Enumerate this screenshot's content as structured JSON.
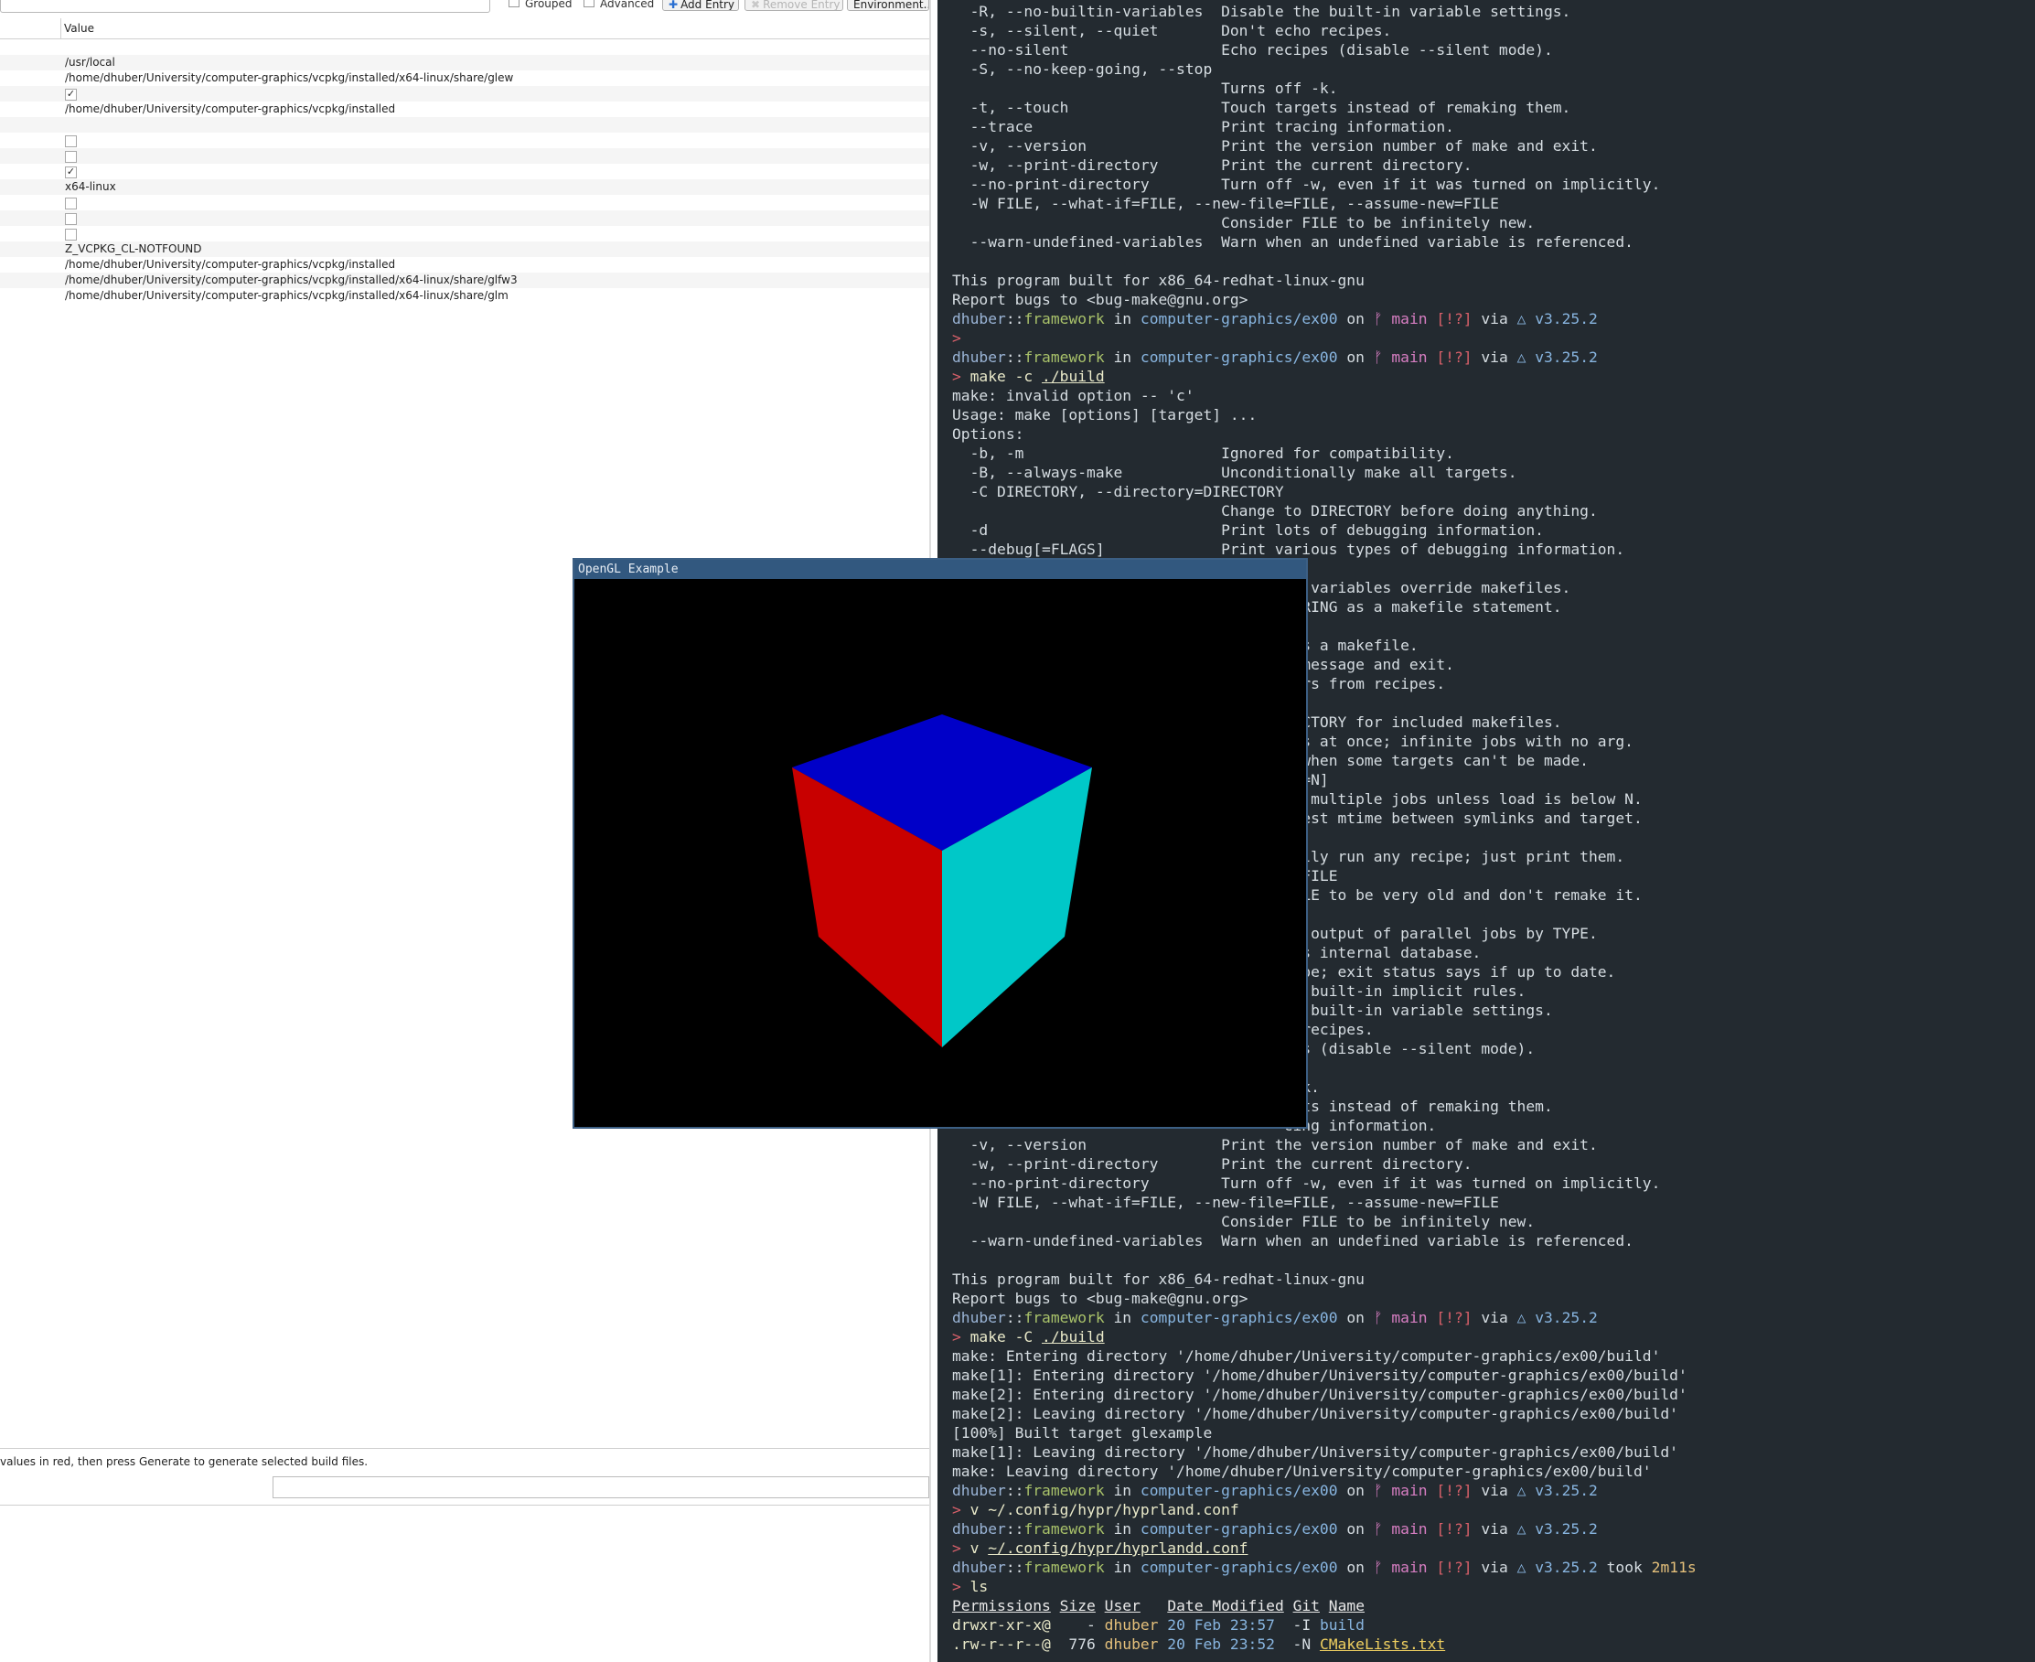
{
  "cmake": {
    "toolbar": {
      "grouped_label": "Grouped",
      "advanced_label": "Advanced",
      "add_entry_label": "Add Entry",
      "remove_entry_label": "Remove Entry",
      "environment_label": "Environment..."
    },
    "header": {
      "value_label": "Value"
    },
    "rows": [
      {
        "type": "text",
        "value": ""
      },
      {
        "type": "text",
        "value": "/usr/local"
      },
      {
        "type": "text",
        "value": "/home/dhuber/University/computer-graphics/vcpkg/installed/x64-linux/share/glew"
      },
      {
        "type": "check",
        "checked": true
      },
      {
        "type": "text",
        "value": "/home/dhuber/University/computer-graphics/vcpkg/installed"
      },
      {
        "type": "text",
        "value": ""
      },
      {
        "type": "check",
        "checked": false
      },
      {
        "type": "check",
        "checked": false
      },
      {
        "type": "check",
        "checked": true
      },
      {
        "type": "text",
        "value": "x64-linux"
      },
      {
        "type": "check",
        "checked": false
      },
      {
        "type": "check",
        "checked": false
      },
      {
        "type": "check",
        "checked": false
      },
      {
        "type": "text",
        "value": "Z_VCPKG_CL-NOTFOUND"
      },
      {
        "type": "text",
        "value": "/home/dhuber/University/computer-graphics/vcpkg/installed"
      },
      {
        "type": "text",
        "value": "/home/dhuber/University/computer-graphics/vcpkg/installed/x64-linux/share/glfw3"
      },
      {
        "type": "text",
        "value": "/home/dhuber/University/computer-graphics/vcpkg/installed/x64-linux/share/glm"
      }
    ],
    "status_text": "values in red, then press Generate to generate selected build files."
  },
  "terminal": {
    "lines": [
      [
        {
          "t": "  -R, --no-builtin-variables  Disable the built-in variable settings."
        }
      ],
      [
        {
          "t": "  -s, --silent, --quiet       Don't echo recipes."
        }
      ],
      [
        {
          "t": "  --no-silent                 Echo recipes (disable --silent mode)."
        }
      ],
      [
        {
          "t": "  -S, --no-keep-going, --stop"
        }
      ],
      [
        {
          "t": "                              Turns off -k."
        }
      ],
      [
        {
          "t": "  -t, --touch                 Touch targets instead of remaking them."
        }
      ],
      [
        {
          "t": "  --trace                     Print tracing information."
        }
      ],
      [
        {
          "t": "  -v, --version               Print the version number of make and exit."
        }
      ],
      [
        {
          "t": "  -w, --print-directory       Print the current directory."
        }
      ],
      [
        {
          "t": "  --no-print-directory        Turn off -w, even if it was turned on implicitly."
        }
      ],
      [
        {
          "t": "  -W FILE, --what-if=FILE, --new-file=FILE, --assume-new=FILE"
        }
      ],
      [
        {
          "t": "                              Consider FILE to be infinitely new."
        }
      ],
      [
        {
          "t": "  --warn-undefined-variables  Warn when an undefined variable is referenced."
        }
      ],
      [
        {
          "t": ""
        }
      ],
      [
        {
          "t": "This program built for x86_64-redhat-linux-gnu"
        }
      ],
      [
        {
          "t": "Report bugs to <bug-make@gnu.org>"
        }
      ],
      [
        {
          "t": "dhuber",
          "c": "t-user"
        },
        {
          "t": "::"
        },
        {
          "t": "framework",
          "c": "t-host"
        },
        {
          "t": " in "
        },
        {
          "t": "computer-graphics/ex00",
          "c": "t-dir"
        },
        {
          "t": " on "
        },
        {
          "t": "ᚠ main",
          "c": "t-branch"
        },
        {
          "t": " "
        },
        {
          "t": "[!?]",
          "c": "t-status"
        },
        {
          "t": " via "
        },
        {
          "t": "△ v3.25.2",
          "c": "t-ver"
        }
      ],
      [
        {
          "t": ">",
          "c": "t-prompt"
        }
      ],
      [
        {
          "t": "dhuber",
          "c": "t-user"
        },
        {
          "t": "::"
        },
        {
          "t": "framework",
          "c": "t-host"
        },
        {
          "t": " in "
        },
        {
          "t": "computer-graphics/ex00",
          "c": "t-dir"
        },
        {
          "t": " on "
        },
        {
          "t": "ᚠ main",
          "c": "t-branch"
        },
        {
          "t": " "
        },
        {
          "t": "[!?]",
          "c": "t-status"
        },
        {
          "t": " via "
        },
        {
          "t": "△ v3.25.2",
          "c": "t-ver"
        }
      ],
      [
        {
          "t": "> ",
          "c": "t-prompt"
        },
        {
          "t": "make -c ",
          "c": "t-cmd"
        },
        {
          "t": "./build",
          "c": "t-cmd t-ul"
        }
      ],
      [
        {
          "t": "make: invalid option -- 'c'"
        }
      ],
      [
        {
          "t": "Usage: make [options] [target] ..."
        }
      ],
      [
        {
          "t": "Options:"
        }
      ],
      [
        {
          "t": "  -b, -m                      Ignored for compatibility."
        }
      ],
      [
        {
          "t": "  -B, --always-make           Unconditionally make all targets."
        }
      ],
      [
        {
          "t": "  -C DIRECTORY, --directory=DIRECTORY"
        }
      ],
      [
        {
          "t": "                              Change to DIRECTORY before doing anything."
        }
      ],
      [
        {
          "t": "  -d                          Print lots of debugging information."
        }
      ],
      [
        {
          "t": "  --debug[=FLAGS]             Print various types of debugging information."
        }
      ],
      [
        {
          "t": ""
        }
      ],
      [
        {
          "t": "                                     nt variables override makefiles."
        }
      ],
      [
        {
          "t": "                                     STRING as a makefile statement."
        }
      ],
      [
        {
          "t": ""
        }
      ],
      [
        {
          "t": "                                      as a makefile."
        }
      ],
      [
        {
          "t": "                                     s message and exit."
        }
      ],
      [
        {
          "t": "                                     rors from recipes."
        }
      ],
      [
        {
          "t": ""
        }
      ],
      [
        {
          "t": "                                     RECTORY for included makefiles."
        }
      ],
      [
        {
          "t": "                                     obs at once; infinite jobs with no arg."
        }
      ],
      [
        {
          "t": "                                     g when some targets can't be made."
        }
      ],
      [
        {
          "t": "                                     d[=N]"
        }
      ],
      [
        {
          "t": "                                     rt multiple jobs unless load is below N."
        }
      ],
      [
        {
          "t": "                                     atest mtime between symlinks and target."
        }
      ],
      [
        {
          "t": ""
        }
      ],
      [
        {
          "t": "                                     ually run any recipe; just print them."
        }
      ],
      [
        {
          "t": "                                     d=FILE"
        }
      ],
      [
        {
          "t": "                                     FILE to be very old and don't remake it."
        }
      ],
      [
        {
          "t": ""
        }
      ],
      [
        {
          "t": "                                     ze output of parallel jobs by TYPE."
        }
      ],
      [
        {
          "t": "                                     e's internal database."
        }
      ],
      [
        {
          "t": "                                     cipe; exit status says if up to date."
        }
      ],
      [
        {
          "t": "                                     he built-in implicit rules."
        }
      ],
      [
        {
          "t": "                                     he built-in variable settings."
        }
      ],
      [
        {
          "t": "                                     o recipes."
        }
      ],
      [
        {
          "t": "                                     pes (disable --silent mode)."
        }
      ],
      [
        {
          "t": ""
        }
      ],
      [
        {
          "t": "                                      -k."
        }
      ],
      [
        {
          "t": "                                     gets instead of remaking them."
        }
      ],
      [
        {
          "t": "                                     cing information."
        }
      ],
      [
        {
          "t": "  -v, --version               Print the version number of make and exit."
        }
      ],
      [
        {
          "t": "  -w, --print-directory       Print the current directory."
        }
      ],
      [
        {
          "t": "  --no-print-directory        Turn off -w, even if it was turned on implicitly."
        }
      ],
      [
        {
          "t": "  -W FILE, --what-if=FILE, --new-file=FILE, --assume-new=FILE"
        }
      ],
      [
        {
          "t": "                              Consider FILE to be infinitely new."
        }
      ],
      [
        {
          "t": "  --warn-undefined-variables  Warn when an undefined variable is referenced."
        }
      ],
      [
        {
          "t": ""
        }
      ],
      [
        {
          "t": "This program built for x86_64-redhat-linux-gnu"
        }
      ],
      [
        {
          "t": "Report bugs to <bug-make@gnu.org>"
        }
      ],
      [
        {
          "t": "dhuber",
          "c": "t-user"
        },
        {
          "t": "::"
        },
        {
          "t": "framework",
          "c": "t-host"
        },
        {
          "t": " in "
        },
        {
          "t": "computer-graphics/ex00",
          "c": "t-dir"
        },
        {
          "t": " on "
        },
        {
          "t": "ᚠ main",
          "c": "t-branch"
        },
        {
          "t": " "
        },
        {
          "t": "[!?]",
          "c": "t-status"
        },
        {
          "t": " via "
        },
        {
          "t": "△ v3.25.2",
          "c": "t-ver"
        }
      ],
      [
        {
          "t": "> ",
          "c": "t-prompt"
        },
        {
          "t": "make -C ",
          "c": "t-cmd"
        },
        {
          "t": "./build",
          "c": "t-cmd t-ul"
        }
      ],
      [
        {
          "t": "make: Entering directory '/home/dhuber/University/computer-graphics/ex00/build'"
        }
      ],
      [
        {
          "t": "make[1]: Entering directory '/home/dhuber/University/computer-graphics/ex00/build'"
        }
      ],
      [
        {
          "t": "make[2]: Entering directory '/home/dhuber/University/computer-graphics/ex00/build'"
        }
      ],
      [
        {
          "t": "make[2]: Leaving directory '/home/dhuber/University/computer-graphics/ex00/build'"
        }
      ],
      [
        {
          "t": "[100%] Built target glexample"
        }
      ],
      [
        {
          "t": "make[1]: Leaving directory '/home/dhuber/University/computer-graphics/ex00/build'"
        }
      ],
      [
        {
          "t": "make: Leaving directory '/home/dhuber/University/computer-graphics/ex00/build'"
        }
      ],
      [
        {
          "t": "dhuber",
          "c": "t-user"
        },
        {
          "t": "::"
        },
        {
          "t": "framework",
          "c": "t-host"
        },
        {
          "t": " in "
        },
        {
          "t": "computer-graphics/ex00",
          "c": "t-dir"
        },
        {
          "t": " on "
        },
        {
          "t": "ᚠ main",
          "c": "t-branch"
        },
        {
          "t": " "
        },
        {
          "t": "[!?]",
          "c": "t-status"
        },
        {
          "t": " via "
        },
        {
          "t": "△ v3.25.2",
          "c": "t-ver"
        }
      ],
      [
        {
          "t": "> ",
          "c": "t-prompt"
        },
        {
          "t": "v ~/.config/hypr/hyprland.conf",
          "c": "t-cmd"
        }
      ],
      [
        {
          "t": "dhuber",
          "c": "t-user"
        },
        {
          "t": "::"
        },
        {
          "t": "framework",
          "c": "t-host"
        },
        {
          "t": " in "
        },
        {
          "t": "computer-graphics/ex00",
          "c": "t-dir"
        },
        {
          "t": " on "
        },
        {
          "t": "ᚠ main",
          "c": "t-branch"
        },
        {
          "t": " "
        },
        {
          "t": "[!?]",
          "c": "t-status"
        },
        {
          "t": " via "
        },
        {
          "t": "△ v3.25.2",
          "c": "t-ver"
        }
      ],
      [
        {
          "t": "> ",
          "c": "t-prompt"
        },
        {
          "t": "v ",
          "c": "t-cmd"
        },
        {
          "t": "~/.config/hypr/hyprlandd.conf",
          "c": "t-cmd t-ul"
        }
      ],
      [
        {
          "t": "dhuber",
          "c": "t-user"
        },
        {
          "t": "::"
        },
        {
          "t": "framework",
          "c": "t-host"
        },
        {
          "t": " in "
        },
        {
          "t": "computer-graphics/ex00",
          "c": "t-dir"
        },
        {
          "t": " on "
        },
        {
          "t": "ᚠ main",
          "c": "t-branch"
        },
        {
          "t": " "
        },
        {
          "t": "[!?]",
          "c": "t-status"
        },
        {
          "t": " via "
        },
        {
          "t": "△ v3.25.2",
          "c": "t-ver"
        },
        {
          "t": " took "
        },
        {
          "t": "2m11s",
          "c": "t-took"
        }
      ],
      [
        {
          "t": "> ",
          "c": "t-prompt"
        },
        {
          "t": "ls",
          "c": "t-cmd"
        }
      ],
      [
        {
          "t": "Permissions",
          "c": "t-hdr"
        },
        {
          "t": " "
        },
        {
          "t": "Size",
          "c": "t-hdr"
        },
        {
          "t": " "
        },
        {
          "t": "User",
          "c": "t-hdr"
        },
        {
          "t": "   "
        },
        {
          "t": "Date Modified",
          "c": "t-hdr"
        },
        {
          "t": " "
        },
        {
          "t": "Git",
          "c": "t-hdr"
        },
        {
          "t": " "
        },
        {
          "t": "Name",
          "c": "t-hdr"
        }
      ],
      [
        {
          "t": "drwxr-xr-x@",
          "c": "t-cmd"
        },
        {
          "t": "    - "
        },
        {
          "t": "dhuber",
          "c": "t-took"
        },
        {
          "t": " "
        },
        {
          "t": "20 Feb 23:57",
          "c": "t-dir"
        },
        {
          "t": "  -I "
        },
        {
          "t": "build",
          "c": "t-dir"
        }
      ],
      [
        {
          "t": ".rw-r--r--@",
          "c": "t-cmd"
        },
        {
          "t": "  776 "
        },
        {
          "t": "dhuber",
          "c": "t-took"
        },
        {
          "t": " "
        },
        {
          "t": "20 Feb 23:52",
          "c": "t-dir"
        },
        {
          "t": "  -N "
        },
        {
          "t": "CMakeLists.txt",
          "c": "t-name-y"
        }
      ]
    ]
  },
  "gl_window": {
    "title": "OpenGL Example",
    "colors": {
      "background": "#000000",
      "top_face": "#0000c8",
      "left_face": "#c80000",
      "right_face": "#00c8c8",
      "titlebar": "#32587f"
    }
  }
}
